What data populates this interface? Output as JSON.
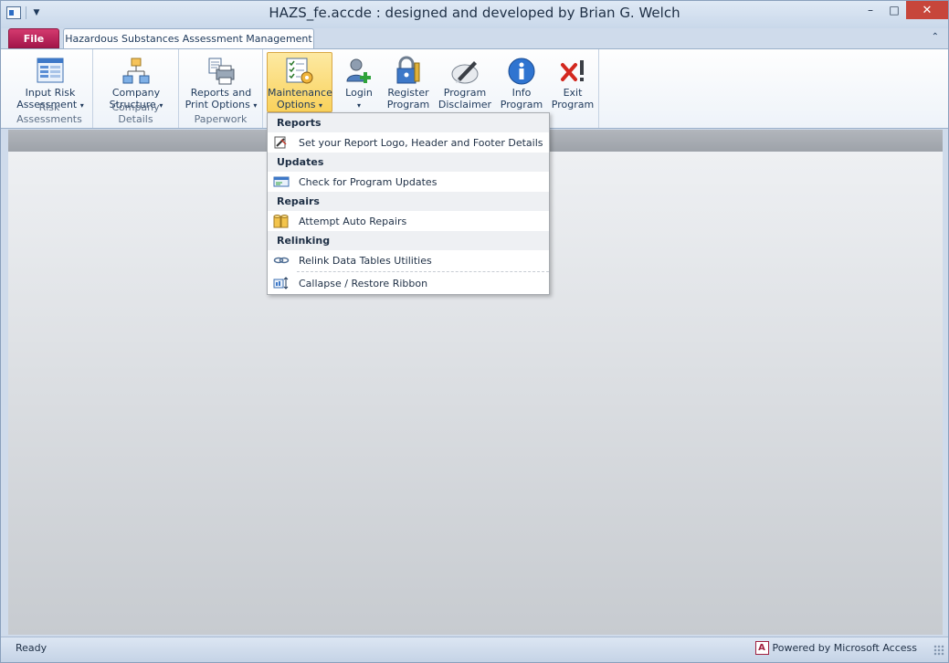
{
  "window": {
    "title": "HAZS_fe.accde : designed and developed by Brian G. Welch",
    "controls": {
      "minimize": "–",
      "maximize": "□",
      "close": "✕"
    }
  },
  "tabs": {
    "file": "File",
    "main": "Hazardous Substances Assessment Management",
    "collapse_glyph": "⌃"
  },
  "ribbon": {
    "groups": [
      {
        "label": "Risk Assessments",
        "buttons": [
          {
            "line1": "Input Risk",
            "line2": "Assessment",
            "arrow": "▾"
          }
        ]
      },
      {
        "label": "Company Details",
        "buttons": [
          {
            "line1": "Company",
            "line2": "Structure",
            "arrow": "▾"
          }
        ]
      },
      {
        "label": "Paperwork",
        "buttons": [
          {
            "line1": "Reports and",
            "line2": "Print Options",
            "arrow": "▾"
          }
        ]
      },
      {
        "label": "",
        "buttons": [
          {
            "line1": "Maintenance",
            "line2": "Options",
            "arrow": "▾"
          },
          {
            "line1": "Login",
            "line2": "",
            "arrow": "▾"
          },
          {
            "line1": "Register",
            "line2": "Program",
            "arrow": ""
          },
          {
            "line1": "Program",
            "line2": "Disclaimer",
            "arrow": ""
          },
          {
            "line1": "Info",
            "line2": "Program",
            "arrow": ""
          },
          {
            "line1": "Exit",
            "line2": "Program",
            "arrow": ""
          }
        ]
      }
    ]
  },
  "menu": {
    "sections": [
      {
        "header": "Reports",
        "items": [
          {
            "label": "Set your Report Logo, Header and Footer Details",
            "icon": "report-logo-icon"
          }
        ]
      },
      {
        "header": "Updates",
        "items": [
          {
            "label": "Check for Program Updates",
            "icon": "update-icon"
          }
        ]
      },
      {
        "header": "Repairs",
        "items": [
          {
            "label": "Attempt Auto Repairs",
            "icon": "database-repair-icon"
          }
        ]
      },
      {
        "header": "Relinking",
        "items": [
          {
            "label": "Relink Data Tables Utilities",
            "icon": "link-icon"
          },
          {
            "label": "Callapse / Restore Ribbon",
            "icon": "ribbon-toggle-icon"
          }
        ]
      }
    ]
  },
  "status": {
    "left": "Ready",
    "logo": "A",
    "right": "Powered by Microsoft Access"
  }
}
